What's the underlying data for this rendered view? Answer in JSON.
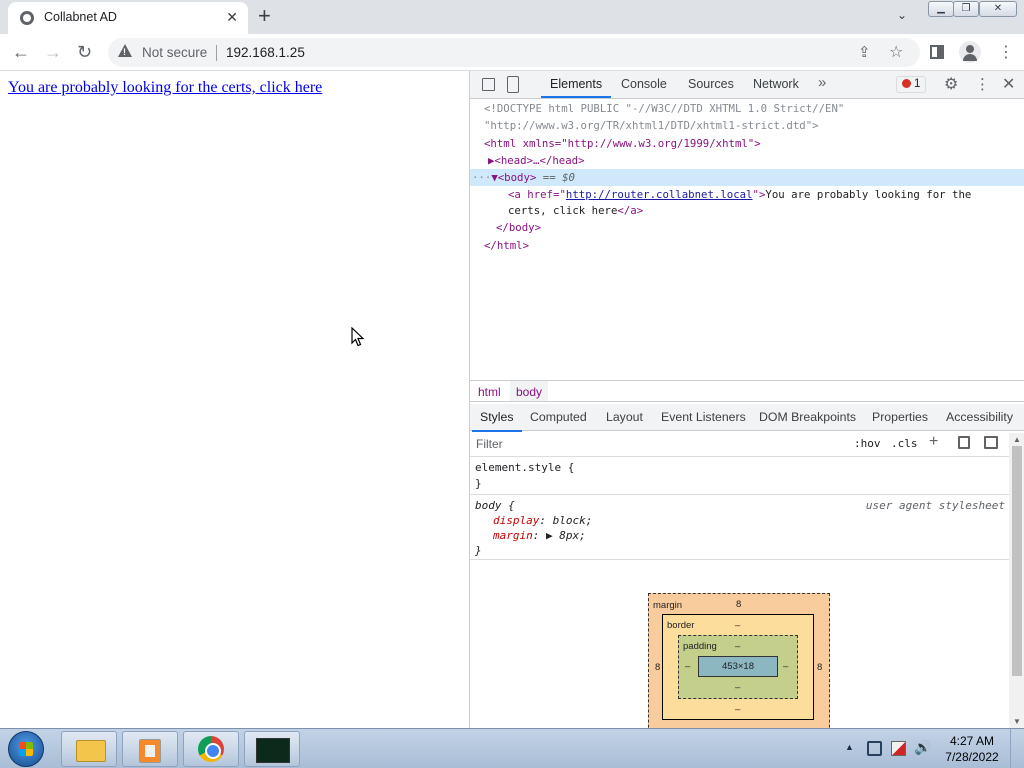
{
  "browser": {
    "tab": {
      "title": "Collabnet AD",
      "close": "✕"
    },
    "new_tab": "+",
    "tab_search": "⌄",
    "window_buttons": {
      "minimize": "▁",
      "maximize": "❐",
      "close": "✕"
    },
    "nav": {
      "back": "←",
      "forward": "→",
      "reload": "↻"
    },
    "omnibox": {
      "security_label": "Not secure",
      "url": "192.168.1.25",
      "share": "⇪",
      "bookmark": "☆"
    },
    "menu": "⋮"
  },
  "page": {
    "link_text": "You are probably looking for the certs, click here"
  },
  "devtools": {
    "tabs": {
      "elements": "Elements",
      "console": "Console",
      "sources": "Sources",
      "network": "Network",
      "more": "»"
    },
    "error_count": "1",
    "gear": "⚙",
    "kebab": "⋮",
    "close": "✕",
    "dom": {
      "doctype_1": "<!DOCTYPE html PUBLIC \"-//W3C//DTD XHTML 1.0 Strict//EN\"",
      "doctype_2": "\"http://www.w3.org/TR/xhtml1/DTD/xhtml1-strict.dtd\">",
      "html_open": "<html xmlns=\"http://www.w3.org/1999/xhtml\">",
      "head": "▶<head>…</head>",
      "body_open": "<body>",
      "body_eq": "== $0",
      "dots": "···",
      "arrow": "▼",
      "a_open": "<a href=\"",
      "a_href": "http://router.collabnet.local",
      "a_close_attr": "\">",
      "a_text_1": "You are probably looking for the",
      "a_text_2": "certs, click here",
      "a_end": "</a>",
      "body_close": "</body>",
      "html_close": "</html>"
    },
    "breadcrumbs": [
      "html",
      "body"
    ],
    "subtabs": [
      "Styles",
      "Computed",
      "Layout",
      "Event Listeners",
      "DOM Breakpoints",
      "Properties",
      "Accessibility"
    ],
    "filter_placeholder": "Filter",
    "hov": ":hov",
    "cls": ".cls",
    "plus": "+",
    "rules": {
      "element_selector": "element.style {",
      "close_brace": "}",
      "body_selector": "body {",
      "source": "user agent stylesheet",
      "prop1_name": "display",
      "prop1_value": "block;",
      "prop2_name": "margin",
      "prop2_value": "▶ 8px;"
    },
    "box_model": {
      "margin_label": "margin",
      "margin_top": "8",
      "margin_left": "8",
      "margin_right": "8",
      "border_label": "border",
      "border_top": "–",
      "border_bottom": "–",
      "padding_label": "padding",
      "padding_top": "–",
      "padding_bottom": "–",
      "padding_left": "–",
      "padding_right": "–",
      "content_size": "453×18"
    }
  },
  "taskbar": {
    "tray_arrow": "▲",
    "volume": "🔊",
    "time": "4:27 AM",
    "date": "7/28/2022"
  }
}
